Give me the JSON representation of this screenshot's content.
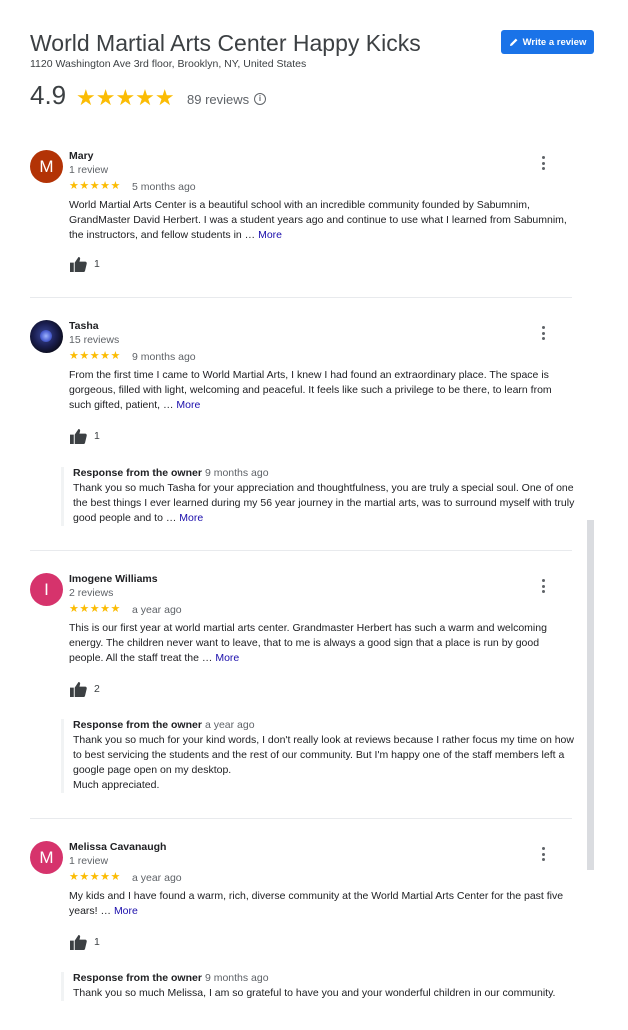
{
  "place": {
    "title": "World Martial Arts Center Happy Kicks",
    "address": "1120 Washington Ave 3rd floor, Brooklyn, NY, United States",
    "rating": "4.9",
    "stars": "★★★★★",
    "review_count": "89 reviews",
    "info_glyph": "i"
  },
  "write_review": {
    "label": "Write a review",
    "icon": "pencil-icon"
  },
  "colors": {
    "accent": "#1a73e8",
    "star": "#fbbc04",
    "link": "#1a0dab"
  },
  "reviews": [
    {
      "avatar_letter": "M",
      "avatar_color": "#b33306",
      "name": "Mary",
      "subcount": "1 review",
      "stars": "★★★★★",
      "age": "5 months ago",
      "text": "World Martial Arts Center is a beautiful school with an incredible community founded by Sabumnim, GrandMaster David Herbert. I was a student years ago and continue to use what I learned from Sabumnim, the instructors, and fellow students in … ",
      "more": "More",
      "likes": "1"
    },
    {
      "avatar_letter": "",
      "avatar_color": "#1a1e4f",
      "name": "Tasha",
      "subcount": "15 reviews",
      "stars": "★★★★★",
      "age": "9 months ago",
      "text": "From the first time I came to World Martial Arts, I knew I had found an extraordinary place.  The space is gorgeous, filled with light, welcoming and peaceful.  It feels like such a privilege to be there, to learn from such gifted, patient, … ",
      "more": "More",
      "likes": "1",
      "owner_title": "Response from the owner",
      "owner_age": "9 months ago",
      "owner_text": "Thank you so much Tasha for your appreciation and thoughtfulness, you are truly a special soul. One of one the best things I ever learned during my 56 year journey in the martial arts, was to surround myself with truly good people and to … ",
      "owner_more": "More"
    },
    {
      "avatar_letter": "I",
      "avatar_color": "#d6336c",
      "name": "Imogene Williams",
      "subcount": "2 reviews",
      "stars": "★★★★★",
      "age": "a year ago",
      "text": "This is our first year at world martial arts center. Grandmaster Herbert has such a warm and welcoming energy. The children never want to leave, that to me is always a good sign that a place is run by good people. All the staff treat the … ",
      "more": "More",
      "likes": "2",
      "owner_title": "Response from the owner",
      "owner_age": "a year ago",
      "owner_text": "Thank you so much for your kind words, I don't really look at reviews because I rather focus my time on how to best servicing the students and the rest of our community. But I'm happy one of the staff members left a google page open on my desktop.",
      "owner_text_2": "Much appreciated."
    },
    {
      "avatar_letter": "M",
      "avatar_color": "#d6336c",
      "name": "Melissa Cavanaugh",
      "subcount": "1 review",
      "stars": "★★★★★",
      "age": "a year ago",
      "text": "My kids and I have found a warm, rich, diverse community at the World Martial Arts Center for the past five years! … ",
      "more": "More",
      "likes": "1",
      "owner_title": "Response from the owner",
      "owner_age": "9 months ago",
      "owner_text": "Thank you so much Melissa, I am so grateful to have you and your wonderful children in our community."
    }
  ]
}
